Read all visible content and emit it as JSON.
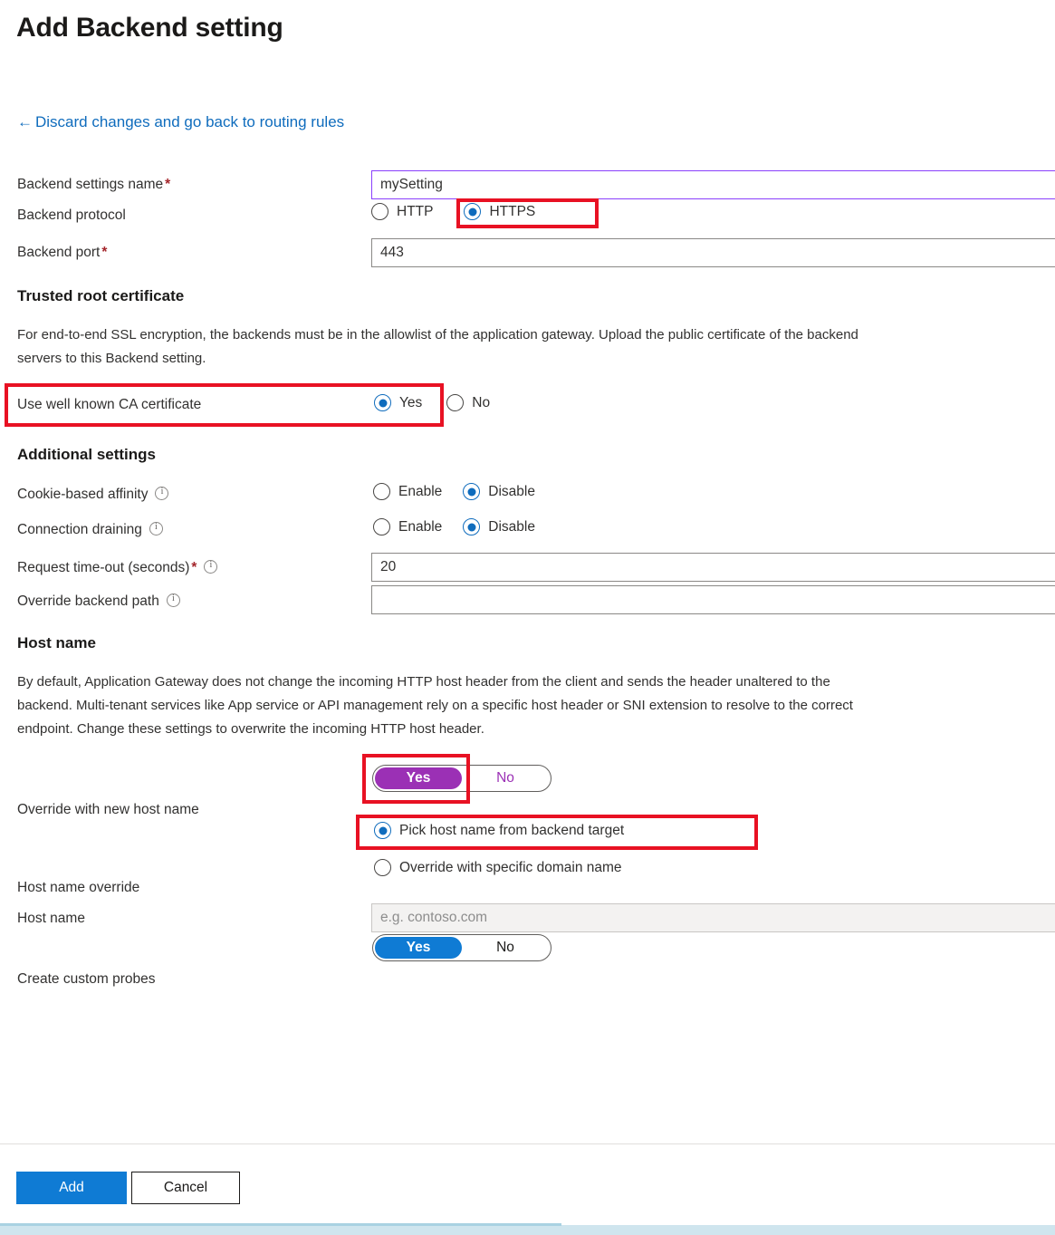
{
  "header": {
    "title": "Add Backend setting",
    "back_link": "Discard changes and go back to routing rules",
    "back_arrow": "←"
  },
  "basics": {
    "name_label": "Backend settings name",
    "name_value": "mySetting",
    "protocol_label": "Backend protocol",
    "protocol_options": [
      "HTTP",
      "HTTPS"
    ],
    "protocol_selected": "HTTPS",
    "port_label": "Backend port",
    "port_value": "443"
  },
  "trusted_root": {
    "heading": "Trusted root certificate",
    "description": "For end-to-end SSL encryption, the backends must be in the allowlist of the application gateway. Upload the public certificate of the backend\nservers to this Backend setting.",
    "ca_label": "Use well known CA certificate",
    "ca_options": [
      "Yes",
      "No"
    ],
    "ca_selected": "Yes"
  },
  "additional": {
    "heading": "Additional settings",
    "cookie_label": "Cookie-based affinity",
    "cookie_options": [
      "Enable",
      "Disable"
    ],
    "cookie_selected": "Disable",
    "draining_label": "Connection draining",
    "draining_options": [
      "Enable",
      "Disable"
    ],
    "draining_selected": "Disable",
    "timeout_label": "Request time-out (seconds)",
    "timeout_value": "20",
    "override_path_label": "Override backend path",
    "override_path_value": ""
  },
  "host_name": {
    "heading": "Host name",
    "description": "By default, Application Gateway does not change the incoming HTTP host header from the client and sends the header unaltered to the\nbackend. Multi-tenant services like App service or API management rely on a specific host header or SNI extension to resolve to the correct\nendpoint. Change these settings to overwrite the incoming HTTP host header.",
    "override_label": "Override with new host name",
    "override_options": [
      "Yes",
      "No"
    ],
    "override_selected": "Yes",
    "pick_radio_label": "Pick host name from backend target",
    "specific_radio_label": "Override with specific domain name",
    "radio_selected": "Pick host name from backend target",
    "host_override_label": "Host name override",
    "host_name_label": "Host name",
    "host_name_placeholder": "e.g. contoso.com",
    "host_name_value": "",
    "probes_label": "Create custom probes",
    "probes_options": [
      "Yes",
      "No"
    ],
    "probes_selected": "Yes"
  },
  "footer": {
    "add_label": "Add",
    "cancel_label": "Cancel"
  },
  "colors": {
    "link": "#0f6cbd",
    "radio_accent": "#0f6cbd",
    "toggle_purple": "#9b30b5",
    "toggle_blue": "#0f7bd4",
    "highlight_red": "#e81123",
    "required_red": "#a4262c",
    "focus_border": "#8a3ffc"
  }
}
